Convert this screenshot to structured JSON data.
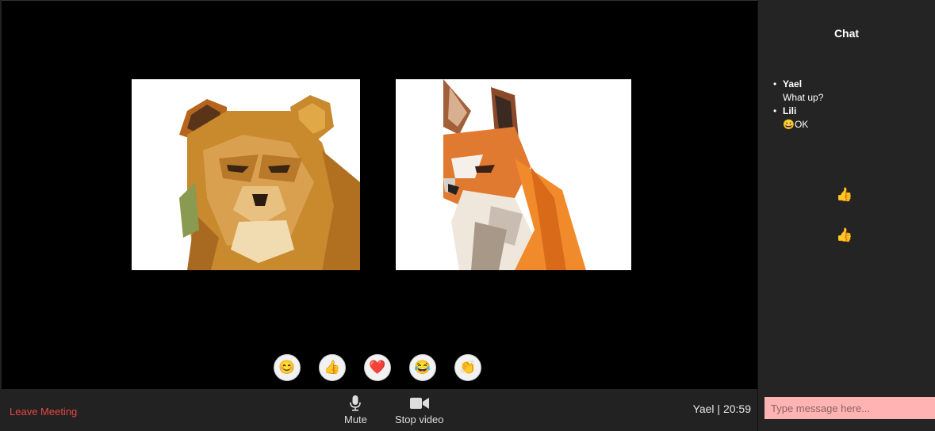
{
  "participants": [
    {
      "name": "lion-video",
      "icon": "lioness-lowpoly"
    },
    {
      "name": "fox-video",
      "icon": "fox-lowpoly"
    }
  ],
  "reactions": [
    {
      "name": "smile",
      "glyph": "😊"
    },
    {
      "name": "thumbs-up",
      "glyph": "👍"
    },
    {
      "name": "heart",
      "glyph": "❤️"
    },
    {
      "name": "laugh",
      "glyph": "😂"
    },
    {
      "name": "clap",
      "glyph": "👏"
    }
  ],
  "bottom_bar": {
    "leave_label": "Leave Meeting",
    "mute_label": "Mute",
    "video_label": "Stop video",
    "user_time": "Yael | 20:59"
  },
  "chat": {
    "title": "Chat",
    "messages": [
      {
        "name": "Yael",
        "text": "What up?"
      },
      {
        "name": "Lili",
        "text": "😀OK"
      }
    ],
    "floating_reactions": [
      "👍",
      "👍"
    ],
    "input_placeholder": "Type message here..."
  },
  "colors": {
    "leave": "#e64545",
    "input_bg": "#ffb3b3",
    "sidebar_bg": "#242424",
    "bar_bg": "#222222"
  }
}
